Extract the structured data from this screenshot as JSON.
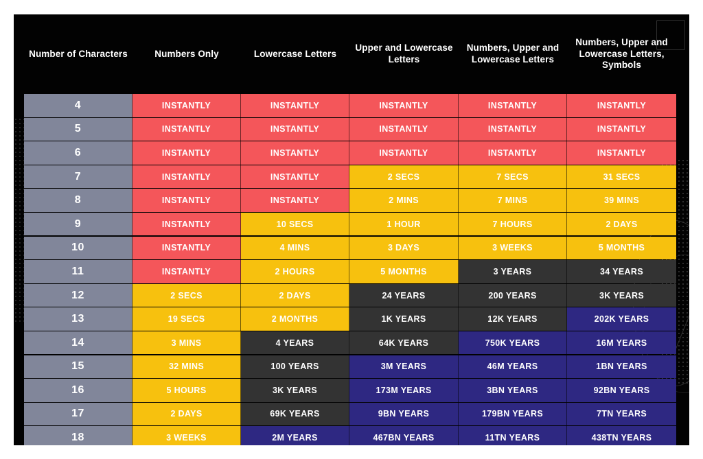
{
  "theme": {
    "panel_bg": "#020202",
    "page_bg": "#ffffff",
    "row_label_bg": "#81869a",
    "color_instant": "#f4565a",
    "color_short": "#f7c10e",
    "color_medium": "#333333",
    "color_strong": "#2e2882",
    "text": "#ffffff"
  },
  "table": {
    "headers": [
      "Number of Characters",
      "Numbers Only",
      "Lowercase Letters",
      "Upper and Lowercase Letters",
      "Numbers, Upper and Lowercase Letters",
      "Numbers, Upper and Lowercase Letters, Symbols"
    ],
    "rows": [
      {
        "chars": "4",
        "cells": [
          {
            "text": "INSTANTLY",
            "level": "red"
          },
          {
            "text": "INSTANTLY",
            "level": "red"
          },
          {
            "text": "INSTANTLY",
            "level": "red"
          },
          {
            "text": "INSTANTLY",
            "level": "red"
          },
          {
            "text": "INSTANTLY",
            "level": "red"
          }
        ]
      },
      {
        "chars": "5",
        "cells": [
          {
            "text": "INSTANTLY",
            "level": "red"
          },
          {
            "text": "INSTANTLY",
            "level": "red"
          },
          {
            "text": "INSTANTLY",
            "level": "red"
          },
          {
            "text": "INSTANTLY",
            "level": "red"
          },
          {
            "text": "INSTANTLY",
            "level": "red"
          }
        ]
      },
      {
        "chars": "6",
        "cells": [
          {
            "text": "INSTANTLY",
            "level": "red"
          },
          {
            "text": "INSTANTLY",
            "level": "red"
          },
          {
            "text": "INSTANTLY",
            "level": "red"
          },
          {
            "text": "INSTANTLY",
            "level": "red"
          },
          {
            "text": "INSTANTLY",
            "level": "red"
          }
        ]
      },
      {
        "chars": "7",
        "cells": [
          {
            "text": "INSTANTLY",
            "level": "red"
          },
          {
            "text": "INSTANTLY",
            "level": "red"
          },
          {
            "text": "2 SECS",
            "level": "yellow"
          },
          {
            "text": "7 SECS",
            "level": "yellow"
          },
          {
            "text": "31 SECS",
            "level": "yellow"
          }
        ]
      },
      {
        "chars": "8",
        "cells": [
          {
            "text": "INSTANTLY",
            "level": "red"
          },
          {
            "text": "INSTANTLY",
            "level": "red"
          },
          {
            "text": "2 MINS",
            "level": "yellow"
          },
          {
            "text": "7 MINS",
            "level": "yellow"
          },
          {
            "text": "39 MINS",
            "level": "yellow"
          }
        ]
      },
      {
        "chars": "9",
        "cells": [
          {
            "text": "INSTANTLY",
            "level": "red"
          },
          {
            "text": "10 SECS",
            "level": "yellow"
          },
          {
            "text": "1 HOUR",
            "level": "yellow"
          },
          {
            "text": "7 HOURS",
            "level": "yellow"
          },
          {
            "text": "2 DAYS",
            "level": "yellow"
          }
        ]
      },
      {
        "chars": "10",
        "cells": [
          {
            "text": "INSTANTLY",
            "level": "red"
          },
          {
            "text": "4 MINS",
            "level": "yellow"
          },
          {
            "text": "3 DAYS",
            "level": "yellow"
          },
          {
            "text": "3 WEEKS",
            "level": "yellow"
          },
          {
            "text": "5 MONTHS",
            "level": "yellow"
          }
        ]
      },
      {
        "chars": "11",
        "cells": [
          {
            "text": "INSTANTLY",
            "level": "red"
          },
          {
            "text": "2 HOURS",
            "level": "yellow"
          },
          {
            "text": "5 MONTHS",
            "level": "yellow"
          },
          {
            "text": "3 YEARS",
            "level": "dark"
          },
          {
            "text": "34 YEARS",
            "level": "dark"
          }
        ]
      },
      {
        "chars": "12",
        "cells": [
          {
            "text": "2 SECS",
            "level": "yellow"
          },
          {
            "text": "2 DAYS",
            "level": "yellow"
          },
          {
            "text": "24 YEARS",
            "level": "dark"
          },
          {
            "text": "200 YEARS",
            "level": "dark"
          },
          {
            "text": "3K YEARS",
            "level": "dark"
          }
        ]
      },
      {
        "chars": "13",
        "cells": [
          {
            "text": "19 SECS",
            "level": "yellow"
          },
          {
            "text": "2 MONTHS",
            "level": "yellow"
          },
          {
            "text": "1K YEARS",
            "level": "dark"
          },
          {
            "text": "12K YEARS",
            "level": "dark"
          },
          {
            "text": "202K YEARS",
            "level": "indigo"
          }
        ]
      },
      {
        "chars": "14",
        "cells": [
          {
            "text": "3 MINS",
            "level": "yellow"
          },
          {
            "text": "4 YEARS",
            "level": "dark"
          },
          {
            "text": "64K YEARS",
            "level": "dark"
          },
          {
            "text": "750K YEARS",
            "level": "indigo"
          },
          {
            "text": "16M YEARS",
            "level": "indigo"
          }
        ]
      },
      {
        "chars": "15",
        "cells": [
          {
            "text": "32 MINS",
            "level": "yellow"
          },
          {
            "text": "100 YEARS",
            "level": "dark"
          },
          {
            "text": "3M YEARS",
            "level": "indigo"
          },
          {
            "text": "46M YEARS",
            "level": "indigo"
          },
          {
            "text": "1BN YEARS",
            "level": "indigo"
          }
        ]
      },
      {
        "chars": "16",
        "cells": [
          {
            "text": "5 HOURS",
            "level": "yellow"
          },
          {
            "text": "3K YEARS",
            "level": "dark"
          },
          {
            "text": "173M YEARS",
            "level": "indigo"
          },
          {
            "text": "3BN YEARS",
            "level": "indigo"
          },
          {
            "text": "92BN YEARS",
            "level": "indigo"
          }
        ]
      },
      {
        "chars": "17",
        "cells": [
          {
            "text": "2 DAYS",
            "level": "yellow"
          },
          {
            "text": "69K YEARS",
            "level": "dark"
          },
          {
            "text": "9BN YEARS",
            "level": "indigo"
          },
          {
            "text": "179BN YEARS",
            "level": "indigo"
          },
          {
            "text": "7TN YEARS",
            "level": "indigo"
          }
        ]
      },
      {
        "chars": "18",
        "cells": [
          {
            "text": "3 WEEKS",
            "level": "yellow"
          },
          {
            "text": "2M YEARS",
            "level": "indigo"
          },
          {
            "text": "467BN YEARS",
            "level": "indigo"
          },
          {
            "text": "11TN YEARS",
            "level": "indigo"
          },
          {
            "text": "438TN YEARS",
            "level": "indigo"
          }
        ]
      }
    ]
  }
}
